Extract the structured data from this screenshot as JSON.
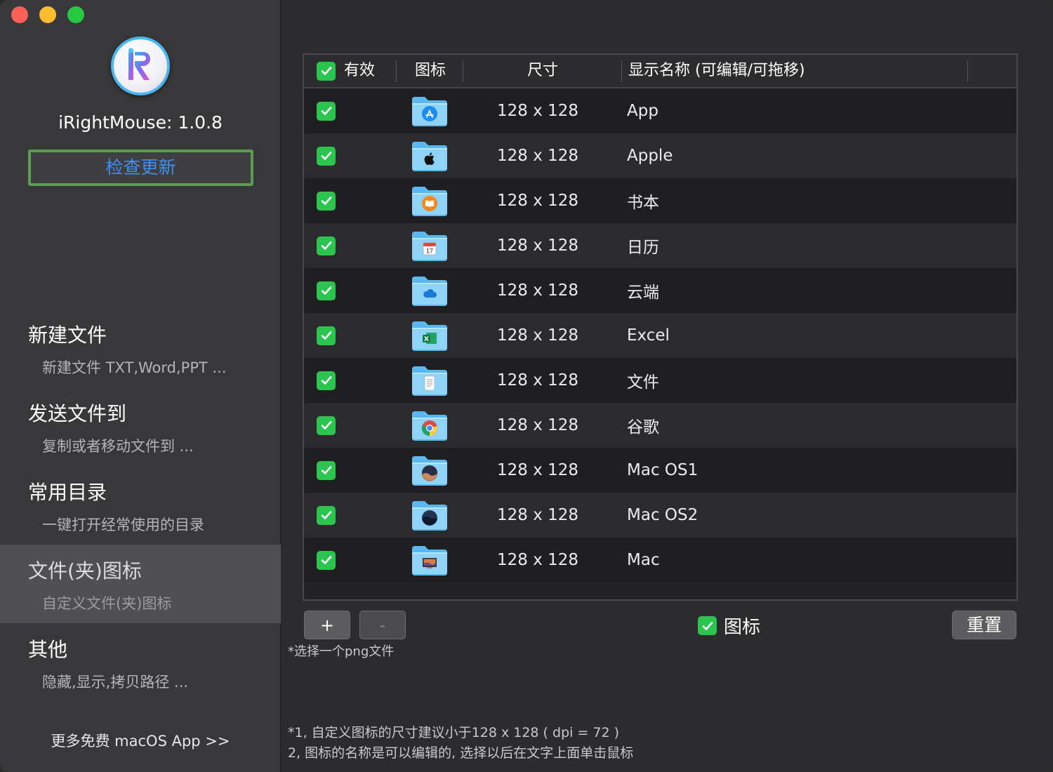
{
  "sidebar": {
    "app_version": "iRightMouse: 1.0.8",
    "check_update_label": "检查更新",
    "items": [
      {
        "title": "新建文件",
        "subtitle": "新建文件 TXT,Word,PPT ..."
      },
      {
        "title": "发送文件到",
        "subtitle": "复制或者移动文件到 ..."
      },
      {
        "title": "常用目录",
        "subtitle": "一键打开经常使用的目录"
      },
      {
        "title": "文件(夹)图标",
        "subtitle": "自定义文件(夹)图标"
      },
      {
        "title": "其他",
        "subtitle": "隐藏,显示,拷贝路径 ..."
      }
    ],
    "more_link": "更多免费 macOS App >>"
  },
  "table": {
    "headers": {
      "enabled": "有效",
      "icon": "图标",
      "size": "尺寸",
      "name": "显示名称 (可编辑/可拖移)"
    },
    "rows": [
      {
        "size": "128 x 128",
        "name": "App",
        "icon": "app-store-icon"
      },
      {
        "size": "128 x 128",
        "name": "Apple",
        "icon": "apple-icon"
      },
      {
        "size": "128 x 128",
        "name": "书本",
        "icon": "books-icon"
      },
      {
        "size": "128 x 128",
        "name": "日历",
        "icon": "calendar-icon"
      },
      {
        "size": "128 x 128",
        "name": "云端",
        "icon": "cloud-icon"
      },
      {
        "size": "128 x 128",
        "name": "Excel",
        "icon": "excel-icon"
      },
      {
        "size": "128 x 128",
        "name": "文件",
        "icon": "document-icon"
      },
      {
        "size": "128 x 128",
        "name": "谷歌",
        "icon": "chrome-icon"
      },
      {
        "size": "128 x 128",
        "name": "Mac OS1",
        "icon": "macos-mojave-icon"
      },
      {
        "size": "128 x 128",
        "name": "Mac OS2",
        "icon": "macos-catalina-icon"
      },
      {
        "size": "128 x 128",
        "name": "Mac",
        "icon": "mac-computer-icon"
      }
    ]
  },
  "controls": {
    "add_label": "+",
    "remove_label": "-",
    "hint": "*选择一个png文件",
    "icon_toggle_label": "图标",
    "reset_label": "重置"
  },
  "notes": {
    "line1": "*1,  自定义图标的尺寸建议小于128 x 128 ( dpi = 72 )",
    "line2": "  2,  图标的名称是可以编辑的,  选择以后在文字上面单击鼠标"
  },
  "colors": {
    "check_green": "#2bc44f",
    "link_blue": "#3b8ff5",
    "update_border": "#5d9b52",
    "folder_blue": "#6cc4f5"
  }
}
